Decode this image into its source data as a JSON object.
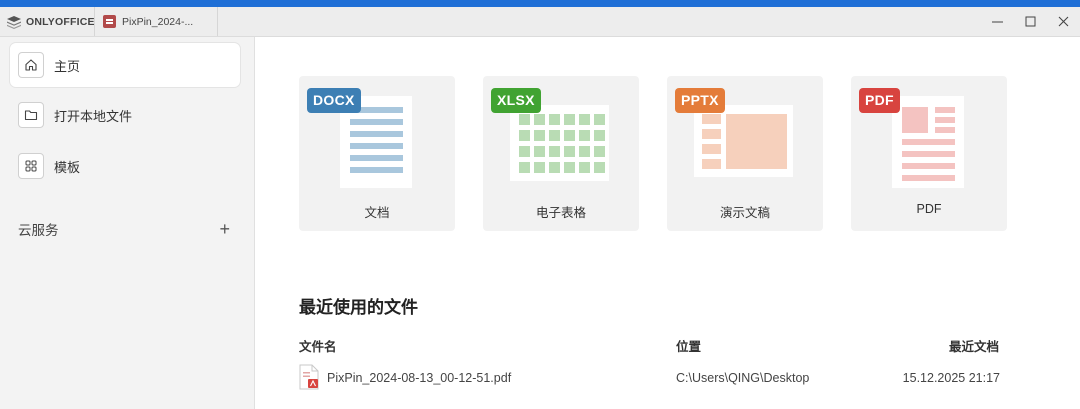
{
  "app": {
    "name": "ONLYOFFICE"
  },
  "tabs": [
    {
      "label": "PixPin_2024-..."
    }
  ],
  "window_controls": {
    "minimize": "—",
    "maximize": "☐",
    "close": "✕"
  },
  "sidebar": {
    "items": [
      {
        "label": "主页",
        "icon": "home-icon",
        "active": true
      },
      {
        "label": "打开本地文件",
        "icon": "folder-icon",
        "active": false
      },
      {
        "label": "模板",
        "icon": "templates-icon",
        "active": false
      }
    ],
    "cloud": {
      "label": "云服务",
      "add": "+"
    }
  },
  "create_cards": [
    {
      "badge": "DOCX",
      "label": "文档",
      "color": "#3d7fb4"
    },
    {
      "badge": "XLSX",
      "label": "电子表格",
      "color": "#41a332"
    },
    {
      "badge": "PPTX",
      "label": "演示文稿",
      "color": "#e47c3a"
    },
    {
      "badge": "PDF",
      "label": "PDF",
      "color": "#d8443f"
    }
  ],
  "recent": {
    "title": "最近使用的文件",
    "columns": {
      "name": "文件名",
      "location": "位置",
      "date": "最近文档"
    },
    "files": [
      {
        "name": "PixPin_2024-08-13_00-12-51.pdf",
        "location": "C:\\Users\\QING\\Desktop",
        "date": "15.12.2025 21:17",
        "icon": "pdf-file-icon"
      }
    ]
  }
}
